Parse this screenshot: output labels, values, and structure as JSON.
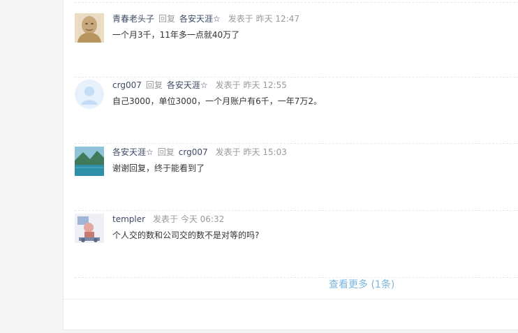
{
  "comments": [
    {
      "user": "青春老头子",
      "reply_label": "回复",
      "reply_to": "各安天涯☆",
      "posted": "发表于 昨天 12:47",
      "text": "一个月3千，11年多一点就40万了",
      "avatar_icon": "bust-statue-avatar"
    },
    {
      "user": "crg007",
      "reply_label": "回复",
      "reply_to": "各安天涯☆",
      "posted": "发表于 昨天 12:55",
      "text": "自己3000，单位3000，一个月账户有6千，一年7万2。",
      "avatar_icon": "default-user-avatar"
    },
    {
      "user": "各安天涯☆",
      "reply_label": "回复",
      "reply_to": "crg007",
      "posted": "发表于 昨天 15:03",
      "text": "谢谢回复，终于能看到了",
      "avatar_icon": "lake-landscape-avatar"
    },
    {
      "user": "templer",
      "posted": "发表于 今天 06:32",
      "text": "个人交的数和公司交的数不是对等的吗?",
      "avatar_icon": "cartoon-avatar"
    }
  ],
  "more_link": "查看更多 (1条)",
  "colors": {
    "username": "#3d4a66",
    "muted": "#999999",
    "link": "#7ab4df"
  }
}
